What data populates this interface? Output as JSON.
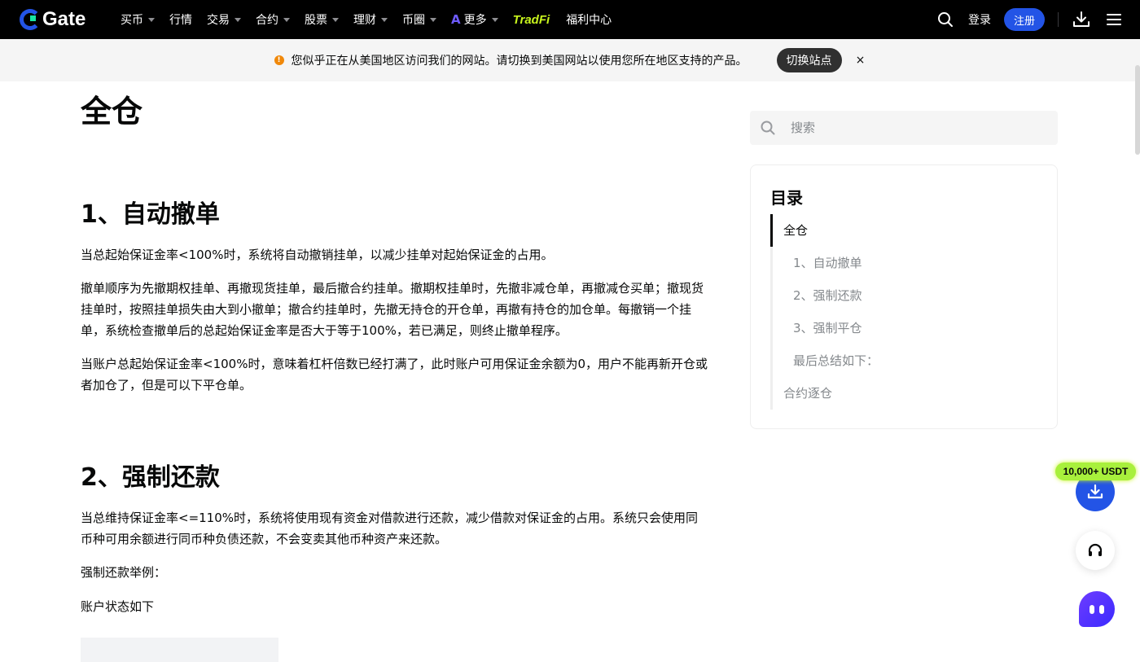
{
  "nav": {
    "logo_text": "Gate",
    "items": [
      {
        "label": "买币",
        "caret": true
      },
      {
        "label": "行情",
        "caret": false
      },
      {
        "label": "交易",
        "caret": true
      },
      {
        "label": "合约",
        "caret": true
      },
      {
        "label": "股票",
        "caret": true
      },
      {
        "label": "理财",
        "caret": true
      },
      {
        "label": "币圈",
        "caret": true
      },
      {
        "label": "更多",
        "caret": true,
        "ai_badge": "A"
      }
    ],
    "tradfi_label": "TradFi",
    "welfare_label": "福利中心",
    "login_label": "登录",
    "register_label": "注册"
  },
  "banner": {
    "message": "您似乎正在从美国地区访问我们的网站。请切换到美国网站以使用您所在地区支持的产品。",
    "switch_label": "切换站点",
    "close_label": "×"
  },
  "article": {
    "title": "全仓",
    "sections": [
      {
        "heading": "1、自动撤单",
        "paragraphs": [
          "当总起始保证金率<100%时，系统将自动撤销挂单，以减少挂单对起始保证金的占用。",
          "撤单顺序为先撤期权挂单、再撤现货挂单，最后撤合约挂单。撤期权挂单时，先撤非减仓单，再撤减仓买单；撤现货挂单时，按照挂单损失由大到小撤单；撤合约挂单时，先撤无持仓的开仓单，再撤有持仓的加仓单。每撤销一个挂单，系统检查撤单后的总起始保证金率是否大于等于100%，若已满足，则终止撤单程序。",
          "当账户总起始保证金率<100%时，意味着杠杆倍数已经打满了，此时账户可用保证金余额为0，用户不能再新开仓或者加仓了，但是可以下平仓单。"
        ]
      },
      {
        "heading": "2、强制还款",
        "paragraphs": [
          "当总维持保证金率<=110%时，系统将使用现有资金对借款进行还款，减少借款对保证金的占用。系统只会使用同币种可用余额进行同币种负债还款，不会变卖其他币种资产来还款。",
          "强制还款举例：",
          "账户状态如下"
        ]
      }
    ]
  },
  "sidebar": {
    "search_placeholder": "搜索",
    "toc_title": "目录",
    "toc_items": [
      {
        "label": "全仓",
        "active": true,
        "indent": false
      },
      {
        "label": "1、自动撤单",
        "active": false,
        "indent": true
      },
      {
        "label": "2、强制还款",
        "active": false,
        "indent": true
      },
      {
        "label": "3、强制平仓",
        "active": false,
        "indent": true
      },
      {
        "label": "最后总结如下：",
        "active": false,
        "indent": true
      },
      {
        "label": "合约逐仓",
        "active": false,
        "indent": false
      }
    ]
  },
  "floaters": {
    "promo_label": "10,000+ USDT"
  },
  "colors": {
    "brand_blue": "#2354e6",
    "brand_green": "#17e5a1",
    "tradfi_lime": "#c8f51d",
    "warning_orange": "#f0880a",
    "text_primary": "#070808",
    "text_secondary": "#84888c"
  }
}
